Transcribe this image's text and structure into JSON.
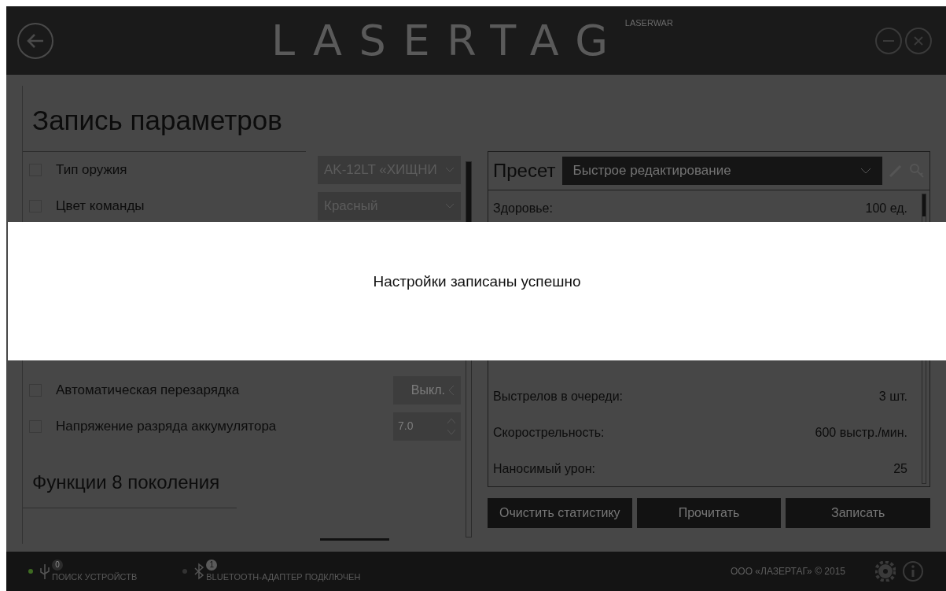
{
  "header": {
    "logo": "LASERTAG",
    "brand": "LASERWAR"
  },
  "left_panel": {
    "title": "Запись параметров",
    "rows": [
      {
        "label": "Тип оружия",
        "checked": false,
        "kind": "dropdown",
        "value": "AK-12LT «ХИЩНИ"
      },
      {
        "label": "Цвет команды",
        "checked": false,
        "kind": "dropdown",
        "value": "Красный"
      },
      {
        "label": "Автоматическая перезарядка",
        "checked": false,
        "kind": "toggle",
        "on": false,
        "value": "Выкл."
      },
      {
        "label": "Напряжение разряда аккумулятора",
        "checked": false,
        "kind": "spinner",
        "value": "7.0"
      }
    ],
    "section": "Функции 8 поколения"
  },
  "right_panel": {
    "preset_label": "Пресет",
    "preset_value": "Быстрое редактирование",
    "stats": [
      {
        "label": "Здоровье:",
        "value": "100 ед."
      },
      {
        "label": "Выстрелов в очереди:",
        "value": "3 шт."
      },
      {
        "label": "Скорострельность:",
        "value": "600 выстр./мин."
      },
      {
        "label": "Наносимый урон:",
        "value": "25"
      }
    ],
    "buttons": [
      "Очистить статистику",
      "Прочитать",
      "Записать"
    ]
  },
  "notification": {
    "message": "Настройки записаны успешно"
  },
  "status_bar": {
    "usb_count": "0",
    "usb_label": "ПОИСК УСТРОЙСТВ",
    "bluetooth_count": "1",
    "bluetooth_label": "BLUETOOTH-АДАПТЕР ПОДКЛЮЧЕН",
    "copyright": "ООО «ЛАЗЕРТАГ» © 2015"
  }
}
